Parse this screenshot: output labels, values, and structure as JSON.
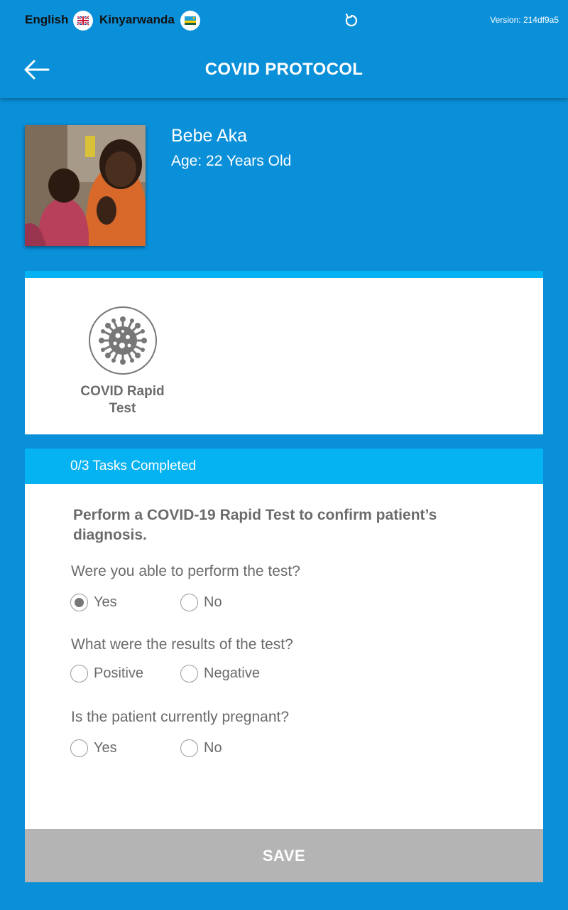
{
  "topbar": {
    "lang_english": "English",
    "lang_kinyarwanda": "Kinyarwanda",
    "version": "Version: 214df9a5"
  },
  "header": {
    "title": "COVID PROTOCOL"
  },
  "patient": {
    "name": "Bebe Aka",
    "age": "Age: 22 Years Old"
  },
  "protocol": {
    "item_label": "COVID Rapid Test"
  },
  "tasks": {
    "status": "0/3 Tasks Completed",
    "instruction": "Perform a COVID-19 Rapid Test to confirm patient’s diagnosis.",
    "q1": {
      "text": "Were you able to perform the test?",
      "opt1": "Yes",
      "opt2": "No",
      "selected": "Yes"
    },
    "q2": {
      "text": "What were the results of the test?",
      "opt1": "Positive",
      "opt2": "Negative",
      "selected": ""
    },
    "q3": {
      "text": "Is the patient currently pregnant?",
      "opt1": "Yes",
      "opt2": "No",
      "selected": ""
    }
  },
  "save_label": "SAVE",
  "colors": {
    "background": "#0a8fd9",
    "accent": "#05b2f2",
    "text_gray": "#6b6b6b",
    "save_button": "#b4b4b4"
  }
}
